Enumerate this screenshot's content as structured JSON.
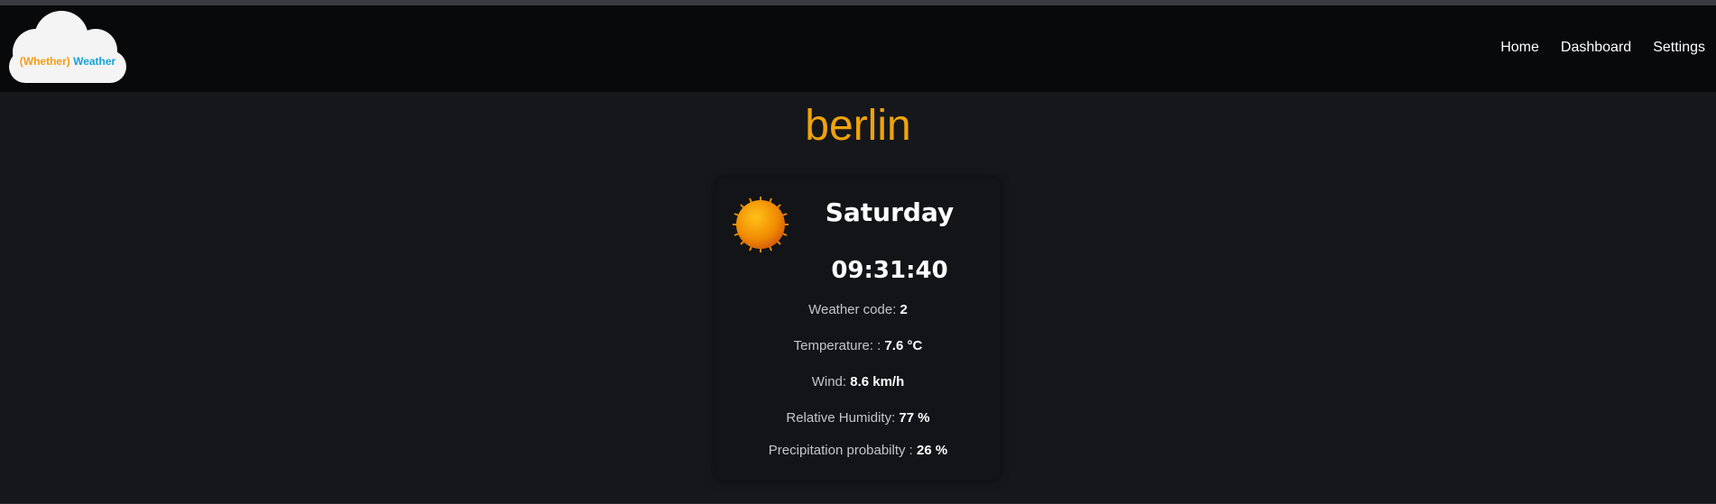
{
  "brand": {
    "part1": "(Whether)",
    "part2": "Weather"
  },
  "nav": {
    "items": [
      {
        "label": "Home"
      },
      {
        "label": "Dashboard"
      },
      {
        "label": "Settings"
      }
    ]
  },
  "city": "berlin",
  "weather_card": {
    "day": "Saturday",
    "time": "09:31:40",
    "icon": "sun-icon",
    "rows": [
      {
        "label": "Weather code: ",
        "value": "2"
      },
      {
        "label": "Temperature: : ",
        "value": "7.6 °C"
      },
      {
        "label": "Wind: ",
        "value": "8.6 km/h"
      },
      {
        "label": "Relative Humidity: ",
        "value": "77 %"
      },
      {
        "label": "Precipitation probabilty : ",
        "value": "26 %"
      }
    ]
  },
  "colors": {
    "accent": "#f0a30a",
    "brand_orange": "#f39c12",
    "brand_blue": "#17a2d9",
    "background": "#15171b",
    "navbar": "#08090b"
  }
}
